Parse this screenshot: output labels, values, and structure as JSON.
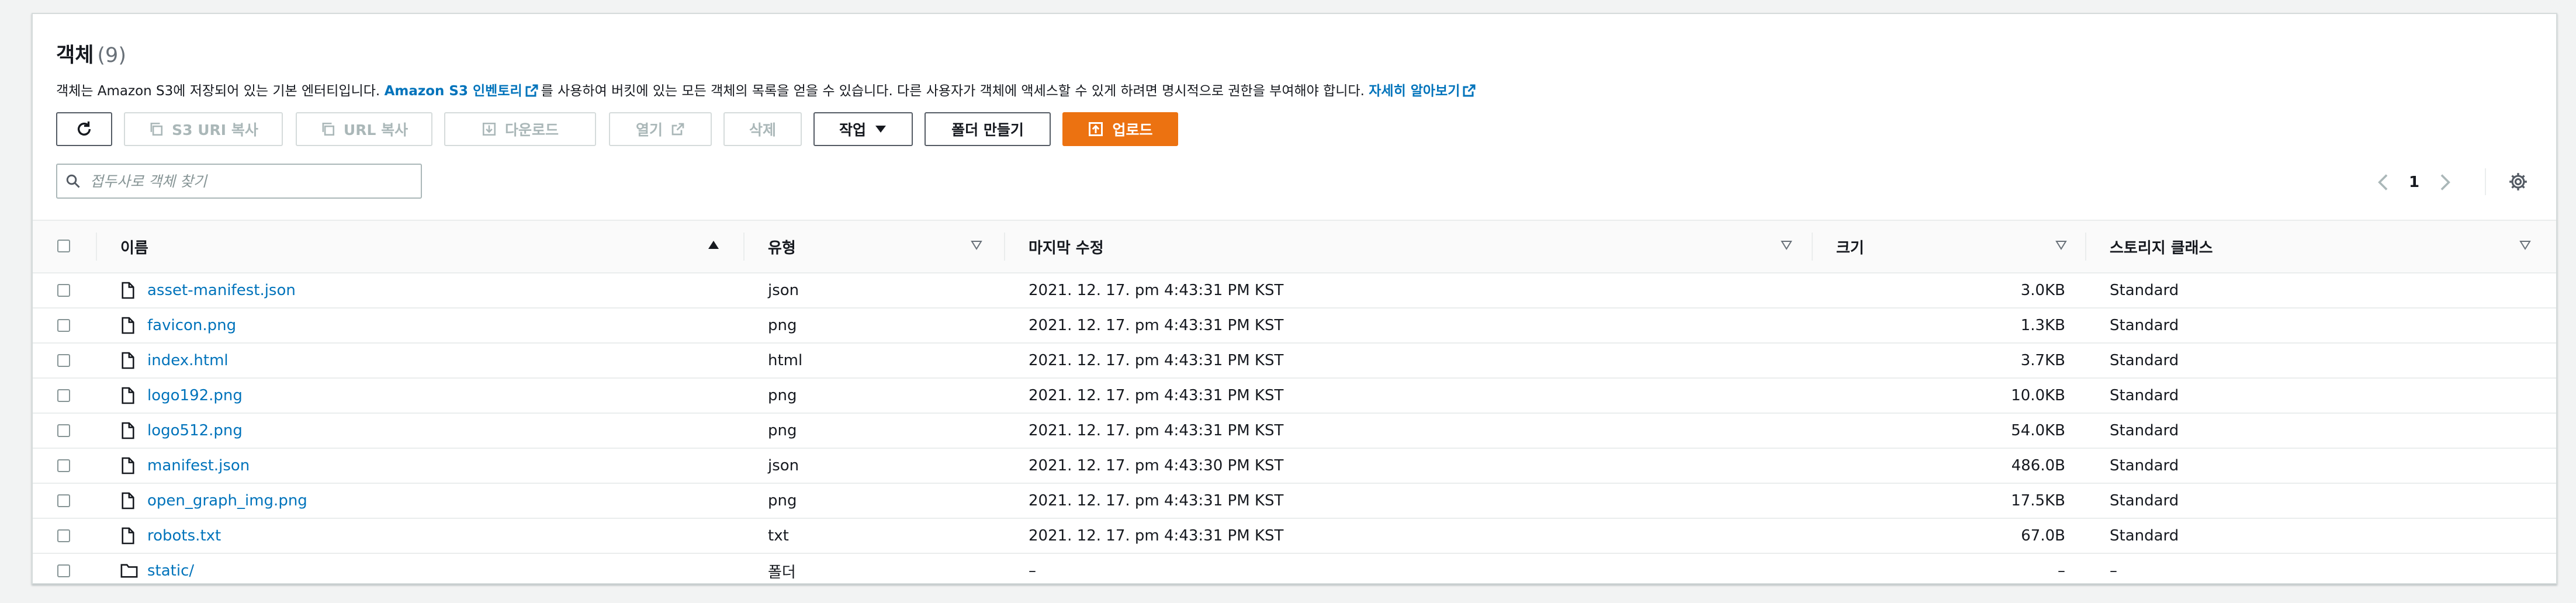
{
  "header": {
    "title": "객체",
    "count": "(9)"
  },
  "description": {
    "part1": "객체는 Amazon S3에 저장되어 있는 기본 엔터티입니다.",
    "link1": "Amazon S3 인벤토리",
    "part2": "를 사용하여 버킷에 있는 모든 객체의 목록을 얻을 수 있습니다. 다른 사용자가 객체에 액세스할 수 있게 하려면 명시적으로 권한을 부여해야 합니다.",
    "link2": "자세히 알아보기"
  },
  "toolbar": {
    "copy_s3_uri": "S3 URI 복사",
    "copy_url": "URL 복사",
    "download": "다운로드",
    "open": "열기",
    "delete": "삭제",
    "actions": "작업",
    "create_folder": "폴더 만들기",
    "upload": "업로드"
  },
  "search": {
    "placeholder": "접두사로 객체 찾기",
    "value": ""
  },
  "pagination": {
    "current_page": "1"
  },
  "table": {
    "columns": {
      "name": "이름",
      "type": "유형",
      "modified": "마지막 수정",
      "size": "크기",
      "storage": "스토리지 클래스"
    },
    "rows": [
      {
        "name": "asset-manifest.json",
        "type": "json",
        "modified": "2021. 12. 17. pm 4:43:31 PM KST",
        "size": "3.0KB",
        "storage": "Standard",
        "icon": "file-icon"
      },
      {
        "name": "favicon.png",
        "type": "png",
        "modified": "2021. 12. 17. pm 4:43:31 PM KST",
        "size": "1.3KB",
        "storage": "Standard",
        "icon": "file-icon"
      },
      {
        "name": "index.html",
        "type": "html",
        "modified": "2021. 12. 17. pm 4:43:31 PM KST",
        "size": "3.7KB",
        "storage": "Standard",
        "icon": "file-icon"
      },
      {
        "name": "logo192.png",
        "type": "png",
        "modified": "2021. 12. 17. pm 4:43:31 PM KST",
        "size": "10.0KB",
        "storage": "Standard",
        "icon": "file-icon"
      },
      {
        "name": "logo512.png",
        "type": "png",
        "modified": "2021. 12. 17. pm 4:43:31 PM KST",
        "size": "54.0KB",
        "storage": "Standard",
        "icon": "file-icon"
      },
      {
        "name": "manifest.json",
        "type": "json",
        "modified": "2021. 12. 17. pm 4:43:30 PM KST",
        "size": "486.0B",
        "storage": "Standard",
        "icon": "file-icon"
      },
      {
        "name": "open_graph_img.png",
        "type": "png",
        "modified": "2021. 12. 17. pm 4:43:31 PM KST",
        "size": "17.5KB",
        "storage": "Standard",
        "icon": "file-icon"
      },
      {
        "name": "robots.txt",
        "type": "txt",
        "modified": "2021. 12. 17. pm 4:43:31 PM KST",
        "size": "67.0B",
        "storage": "Standard",
        "icon": "file-icon"
      },
      {
        "name": "static/",
        "type": "폴더",
        "modified": "–",
        "size": "–",
        "storage": "–",
        "icon": "folder-icon"
      }
    ]
  },
  "colors": {
    "accent": "#ec7211",
    "link": "#0073bb",
    "text": "#16191f",
    "border": "#aab7b8"
  }
}
